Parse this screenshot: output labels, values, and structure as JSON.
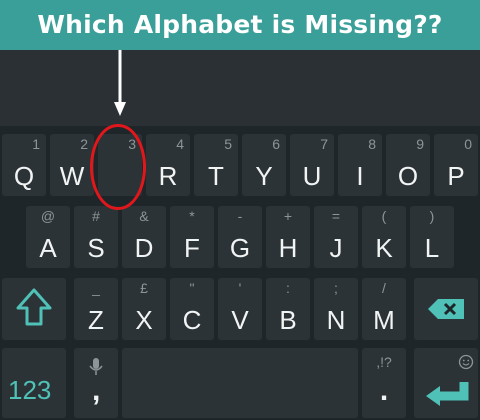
{
  "title": "Which Alphabet is Missing??",
  "row1": [
    {
      "hint": "1",
      "label": "Q"
    },
    {
      "hint": "2",
      "label": "W"
    },
    {
      "hint": "3",
      "label": ""
    },
    {
      "hint": "4",
      "label": "R"
    },
    {
      "hint": "5",
      "label": "T"
    },
    {
      "hint": "6",
      "label": "Y"
    },
    {
      "hint": "7",
      "label": "U"
    },
    {
      "hint": "8",
      "label": "I"
    },
    {
      "hint": "9",
      "label": "O"
    },
    {
      "hint": "0",
      "label": "P"
    }
  ],
  "row2": [
    {
      "hint": "@",
      "label": "A"
    },
    {
      "hint": "#",
      "label": "S"
    },
    {
      "hint": "&",
      "label": "D"
    },
    {
      "hint": "*",
      "label": "F"
    },
    {
      "hint": "-",
      "label": "G"
    },
    {
      "hint": "+",
      "label": "H"
    },
    {
      "hint": "=",
      "label": "J"
    },
    {
      "hint": "(",
      "label": "K"
    },
    {
      "hint": ")",
      "label": "L"
    }
  ],
  "row3": [
    {
      "hint": "_",
      "label": "Z"
    },
    {
      "hint": "£",
      "label": "X"
    },
    {
      "hint": "\"",
      "label": "C"
    },
    {
      "hint": "'",
      "label": "V"
    },
    {
      "hint": ":",
      "label": "B"
    },
    {
      "hint": ";",
      "label": "N"
    },
    {
      "hint": "/",
      "label": "M"
    }
  ],
  "bottom": {
    "numbers_label": "123",
    "comma_label": ",",
    "period_label": ".",
    "punct_hint": ",!?"
  },
  "colors": {
    "accent": "#3a9f99",
    "highlight": "#e2171c",
    "key": "#2b3337",
    "keyboard": "#1f2629"
  }
}
